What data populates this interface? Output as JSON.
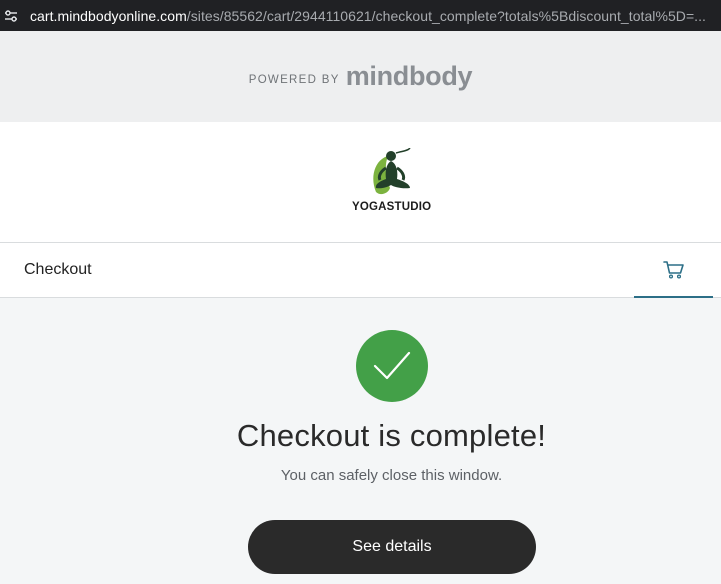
{
  "browser": {
    "url_host": "cart.mindbodyonline.com",
    "url_path": "/sites/85562/cart/2944110621/checkout_complete?totals%5Bdiscount_total%5D=..."
  },
  "header": {
    "powered_by": "POWERED BY",
    "brand": "mindbody"
  },
  "studio": {
    "name": "YOGASTUDIO"
  },
  "nav": {
    "title": "Checkout",
    "cart_icon": "cart-icon"
  },
  "main": {
    "status_icon": "check-icon",
    "heading": "Checkout is complete!",
    "subtext": "You can safely close this window.",
    "button_label": "See details"
  },
  "colors": {
    "success": "#43a048",
    "accent": "#2c6f87",
    "button": "#2a2a2a"
  }
}
